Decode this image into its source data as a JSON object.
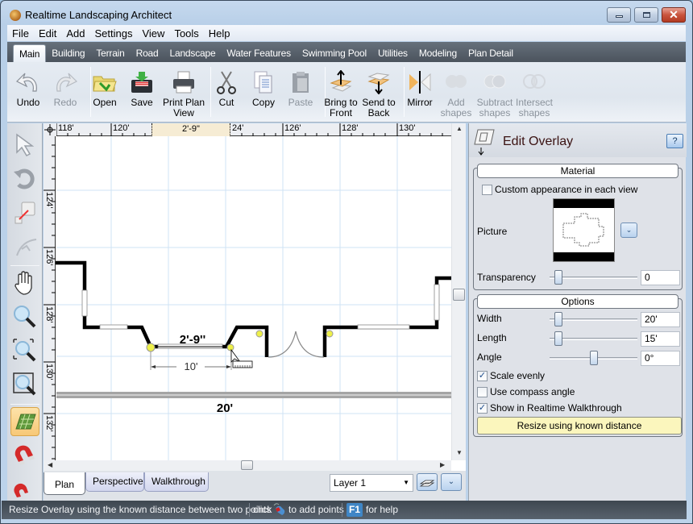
{
  "window": {
    "title": "Realtime Landscaping Architect",
    "controls": {
      "minimize": "minimize",
      "maximize": "maximize",
      "close": "✕"
    }
  },
  "menu": [
    "File",
    "Edit",
    "Add",
    "Settings",
    "View",
    "Tools",
    "Help"
  ],
  "ribbon_tabs": [
    {
      "label": "Main",
      "active": true
    },
    {
      "label": "Building"
    },
    {
      "label": "Terrain"
    },
    {
      "label": "Road"
    },
    {
      "label": "Landscape"
    },
    {
      "label": "Water Features"
    },
    {
      "label": "Swimming Pool"
    },
    {
      "label": "Utilities"
    },
    {
      "label": "Modeling"
    },
    {
      "label": "Plan Detail"
    }
  ],
  "ribbon": {
    "undo": "Undo",
    "redo": "Redo",
    "open": "Open",
    "save": "Save",
    "print": "Print Plan View",
    "cut": "Cut",
    "copy": "Copy",
    "paste": "Paste",
    "bring_front": "Bring to Front",
    "send_back": "Send to Back",
    "mirror": "Mirror",
    "add_shapes": "Add shapes",
    "subtract_shapes": "Subtract shapes",
    "intersect_shapes": "Intersect shapes"
  },
  "left_tools": [
    "select-arrow",
    "rotate",
    "resize",
    "arc",
    "pan-hand",
    "zoom",
    "zoom-region",
    "zoom-fit",
    "overlay-grid",
    "snap-magnet",
    "snap-magnet-2"
  ],
  "ruler": {
    "top_labels": [
      "118'",
      "120'",
      "24'",
      "126'",
      "128'",
      "130'"
    ],
    "highlight_label": "2'-9\"",
    "left_labels": [
      "124'",
      "126'",
      "128'",
      "130'",
      "132'"
    ]
  },
  "canvas": {
    "dimension_label": "2'-9''",
    "measure_label": "10'",
    "width_label": "20'"
  },
  "view_tabs": [
    {
      "label": "Plan",
      "active": true
    },
    {
      "label": "Perspective"
    },
    {
      "label": "Walkthrough"
    }
  ],
  "layer": {
    "selected": "Layer 1"
  },
  "panel": {
    "title": "Edit Overlay",
    "help": "?",
    "material": {
      "header": "Material",
      "custom_appearance": {
        "label": "Custom appearance in each view",
        "checked": false
      },
      "picture_label": "Picture",
      "transparency_label": "Transparency",
      "transparency_value": "0",
      "transparency_fraction": 0.1
    },
    "options": {
      "header": "Options",
      "width_label": "Width",
      "width_value": "20'",
      "width_fraction": 0.1,
      "length_label": "Length",
      "length_value": "15'",
      "length_fraction": 0.1,
      "angle_label": "Angle",
      "angle_value": "0°",
      "angle_fraction": 0.5,
      "scale_evenly": {
        "label": "Scale evenly",
        "checked": true
      },
      "compass_angle": {
        "label": "Use compass angle",
        "checked": false
      },
      "show_walkthrough": {
        "label": "Show in Realtime Walkthrough",
        "checked": true
      },
      "resize_button": "Resize using known distance"
    }
  },
  "status": {
    "message": "Resize Overlay using the known distance between two points",
    "click": "click",
    "add_points": "to add points",
    "f1": "F1",
    "help": "for help"
  }
}
